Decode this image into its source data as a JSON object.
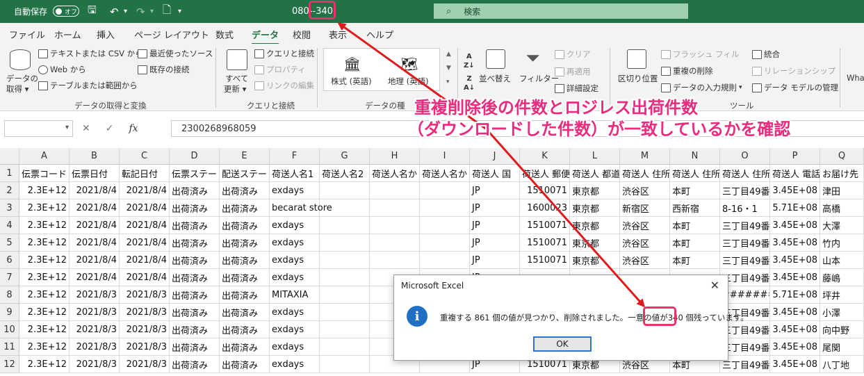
{
  "titlebar": {
    "autosave_label": "自動保存",
    "autosave_state": "オフ",
    "filename": "080--340",
    "search_placeholder": "検索"
  },
  "menu": {
    "tabs": [
      "ファイル",
      "ホーム",
      "挿入",
      "ページ レイアウト",
      "数式",
      "データ",
      "校閲",
      "表示",
      "ヘルプ"
    ],
    "active": "データ"
  },
  "ribbon": {
    "get_data_line1": "データの",
    "get_data_line2": "取得 ▾",
    "from_text_csv": "テキストまたは CSV から",
    "from_web": "Web から",
    "from_table": "テーブルまたは範囲から",
    "recent_sources": "最近使ったソース",
    "existing_connections": "既存の接続",
    "group_get_transform": "データの取得と変換",
    "refresh_all_line1": "すべて",
    "refresh_all_line2": "更新 ▾",
    "queries_connections": "クエリと接続",
    "properties": "プロパティ",
    "edit_links": "リンクの編集",
    "group_queries": "クエリと接続",
    "stocks": "株式 (英語)",
    "geography": "地理 (英語)",
    "group_datatypes": "データの種",
    "sort": "並べ替え",
    "filter": "フィルター",
    "clear": "クリア",
    "reapply": "再適用",
    "advanced": "詳細設定",
    "text_to_columns": "区切り位置",
    "flash_fill": "フラッシュ フィル",
    "remove_duplicates": "重複の削除",
    "data_validation": "データの入力規則",
    "consolidate": "統合",
    "relationships": "リレーションシップ",
    "data_model": "データ モデルの管理",
    "group_tools": "ツール",
    "whatif": "Wha"
  },
  "formula": {
    "cancel_symbol": "✕",
    "enter_symbol": "✓",
    "fx_symbol": "fx",
    "content": "2300268968059"
  },
  "sheet": {
    "columns": [
      "A",
      "B",
      "C",
      "D",
      "E",
      "F",
      "G",
      "H",
      "I",
      "J",
      "K",
      "L",
      "M",
      "N",
      "O",
      "P",
      "Q"
    ],
    "rows": [
      [
        "伝票コード",
        "伝票日付",
        "転記日付",
        "伝票ステー",
        "配送ステー",
        "荷送人名1",
        "荷送人名2",
        "荷送人名か",
        "荷送人名か",
        "荷送人 国",
        "荷送人 郵便",
        "荷送人 都道",
        "荷送人 住所",
        "荷送人 住所",
        "荷送人 住所",
        "荷送人 電話",
        "お届け先"
      ],
      [
        "2.3E+12",
        "2021/8/4",
        "2021/8/4",
        "出荷済み",
        "出荷済み",
        "exdays",
        "",
        "",
        "",
        "JP",
        "1510071",
        "東京都",
        "渋谷区",
        "本町",
        "三丁目49番",
        "3.45E+08",
        "津田"
      ],
      [
        "2.3E+12",
        "2021/8/4",
        "2021/8/4",
        "出荷済み",
        "出荷済み",
        "becarat store",
        "",
        "",
        "",
        "JP",
        "1600023",
        "東京都",
        "新宿区",
        "西新宿",
        "8-16・1",
        "5.71E+08",
        "高橋"
      ],
      [
        "2.3E+12",
        "2021/8/4",
        "2021/8/4",
        "出荷済み",
        "出荷済み",
        "exdays",
        "",
        "",
        "",
        "JP",
        "1510071",
        "東京都",
        "渋谷区",
        "本町",
        "三丁目49番",
        "3.45E+08",
        "大澤"
      ],
      [
        "2.3E+12",
        "2021/8/4",
        "2021/8/4",
        "出荷済み",
        "出荷済み",
        "exdays",
        "",
        "",
        "",
        "JP",
        "1510071",
        "東京都",
        "渋谷区",
        "本町",
        "三丁目49番",
        "3.45E+08",
        "竹内"
      ],
      [
        "2.3E+12",
        "2021/8/4",
        "2021/8/4",
        "出荷済み",
        "出荷済み",
        "exdays",
        "",
        "",
        "",
        "JP",
        "1510071",
        "東京都",
        "渋谷区",
        "本町",
        "三丁目49番",
        "3.45E+08",
        "山本"
      ],
      [
        "2.3E+12",
        "2021/8/4",
        "2021/8/4",
        "出荷済み",
        "出荷済み",
        "exdays",
        "",
        "",
        "",
        "JP",
        "",
        "",
        "",
        "",
        "三丁目49番",
        "3.45E+08",
        "藤嶋"
      ],
      [
        "2.3E+12",
        "2021/8/3",
        "2021/8/3",
        "出荷済み",
        "出荷済み",
        "MITAXIA",
        "",
        "",
        "",
        "",
        "",
        "",
        "",
        "",
        "#######",
        "5.71E+08",
        "坪井"
      ],
      [
        "2.3E+12",
        "2021/8/3",
        "2021/8/3",
        "出荷済み",
        "出荷済み",
        "exdays",
        "",
        "",
        "",
        "",
        "",
        "",
        "",
        "",
        "三丁目49番",
        "3.45E+08",
        "小澤"
      ],
      [
        "2.3E+12",
        "2021/8/3",
        "2021/8/3",
        "出荷済み",
        "出荷済み",
        "exdays",
        "",
        "",
        "",
        "",
        "",
        "",
        "",
        "",
        "三丁目49番",
        "3.45E+08",
        "向中野"
      ],
      [
        "2.3E+12",
        "2021/8/3",
        "2021/8/3",
        "出荷済み",
        "出荷済み",
        "exdays",
        "",
        "",
        "",
        "",
        "",
        "",
        "",
        "",
        "三丁目49番",
        "3.45E+08",
        "尾関"
      ],
      [
        "2.3E+12",
        "2021/8/3",
        "2021/8/3",
        "出荷済み",
        "出荷済み",
        "exdays",
        "",
        "",
        "",
        "JP",
        "1510071",
        "東京都",
        "渋谷区",
        "本町",
        "三丁目49番",
        "3.45E+08",
        "八丁地"
      ]
    ]
  },
  "dialog": {
    "title": "Microsoft Excel",
    "message_before": "重複する 861 個の値が見つかり、削除されました。一意の値が",
    "unique_count": "340 個",
    "message_after": "残っています。",
    "ok_label": "OK"
  },
  "annotation": {
    "line1": "重複削除後の件数とロジレス出荷件数",
    "line2": "（ダウンロードした件数）が一致しているかを確認"
  },
  "colors": {
    "excel_green": "#217346",
    "highlight_pink": "#e8336a",
    "arrow_red": "#e0191d"
  }
}
